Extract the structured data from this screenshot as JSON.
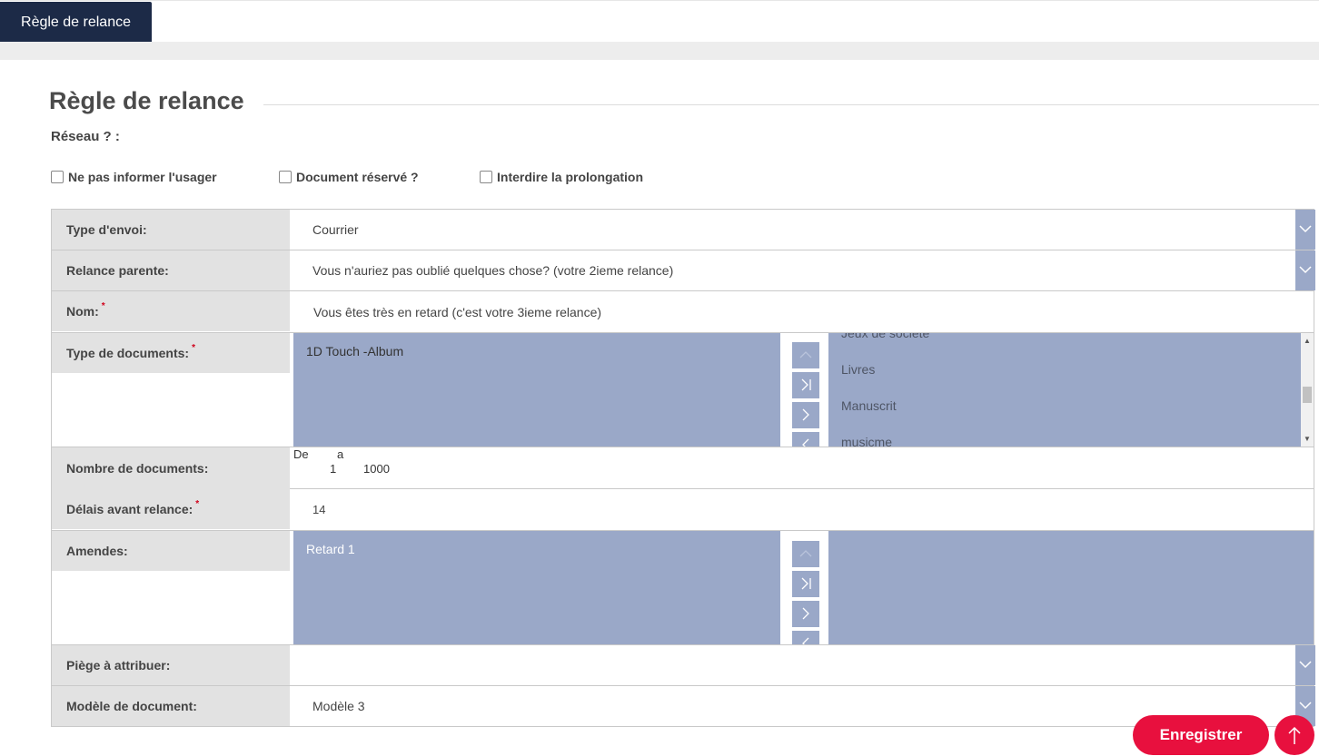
{
  "tab": {
    "label": "Règle de relance"
  },
  "section": {
    "title": "Règle de relance",
    "reseau_label": "Réseau ? :"
  },
  "checkboxes": [
    {
      "label": "Ne pas informer l'usager"
    },
    {
      "label": "Document réservé ?"
    },
    {
      "label": "Interdire la prolongation"
    }
  ],
  "form": {
    "type_envoi": {
      "label": "Type d'envoi:",
      "value": "Courrier"
    },
    "relance_parente": {
      "label": "Relance parente:",
      "value": "Vous n'auriez pas oublié quelques chose?  (votre 2ieme relance)"
    },
    "nom": {
      "label": "Nom:",
      "required": "*",
      "value": "Vous êtes très en retard (c'est votre 3ieme relance)"
    },
    "type_documents": {
      "label": "Type de documents:",
      "required": "*",
      "selected": [
        "1D Touch -Album"
      ],
      "available": [
        "Jeux de société",
        "Livres",
        "Manuscrit",
        "musicme"
      ]
    },
    "nombre_documents": {
      "label": "Nombre de documents:",
      "from_label": "De",
      "to_label": "a",
      "from_value": "1",
      "to_value": "1000"
    },
    "delais": {
      "label": "Délais avant relance:",
      "required": "*",
      "value": "14"
    },
    "amendes": {
      "label": "Amendes:",
      "selected": [
        "Retard 1"
      ],
      "available": []
    },
    "piege": {
      "label": "Piège à attribuer:",
      "value": ""
    },
    "modele": {
      "label": "Modèle de document:",
      "value": "Modèle 3"
    }
  },
  "actions": {
    "save_label": "Enregistrer"
  },
  "colors": {
    "tab_bg": "#1c2a47",
    "list_bg": "#9aa8c8",
    "accent": "#e8103e",
    "label_bg": "#e2e2e2"
  }
}
